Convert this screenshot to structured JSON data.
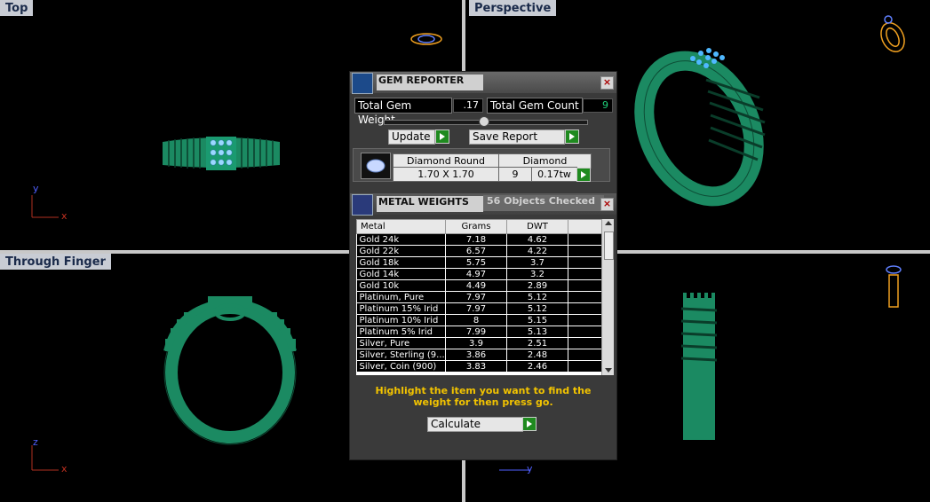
{
  "viewports": {
    "top": {
      "label": "Top",
      "axes": {
        "vertical": "y",
        "horizontal": "x"
      }
    },
    "perspective": {
      "label": "Perspective"
    },
    "through_finger": {
      "label": "Through Finger",
      "axes": {
        "vertical": "z",
        "horizontal": "x"
      }
    },
    "side": {
      "axes": {
        "horizontal": "y"
      }
    }
  },
  "gem_reporter": {
    "title": "GEM REPORTER",
    "total_gem_weight_label": "Total Gem Weight",
    "total_gem_weight": ".17",
    "total_gem_count_label": "Total Gem Count",
    "total_gem_count": "9",
    "update_label": "Update",
    "save_report_label": "Save Report",
    "gem": {
      "shape": "Diamond Round",
      "size": "1.70 X 1.70",
      "type": "Diamond",
      "count": "9",
      "weight": "0.17tw"
    }
  },
  "metal_weights": {
    "title": "METAL WEIGHTS",
    "objects_checked": "56 Objects Checked",
    "columns": [
      "Metal",
      "Grams",
      "DWT"
    ],
    "rows": [
      {
        "metal": "Gold 24k",
        "grams": "7.18",
        "dwt": "4.62"
      },
      {
        "metal": "Gold 22k",
        "grams": "6.57",
        "dwt": "4.22"
      },
      {
        "metal": "Gold 18k",
        "grams": "5.75",
        "dwt": "3.7"
      },
      {
        "metal": "Gold 14k",
        "grams": "4.97",
        "dwt": "3.2"
      },
      {
        "metal": "Gold 10k",
        "grams": "4.49",
        "dwt": "2.89"
      },
      {
        "metal": "Platinum, Pure",
        "grams": "7.97",
        "dwt": "5.12"
      },
      {
        "metal": "Platinum 15% Irid",
        "grams": "7.97",
        "dwt": "5.12"
      },
      {
        "metal": "Platinum 10% Irid",
        "grams": "8",
        "dwt": "5.15"
      },
      {
        "metal": "Platinum 5% Irid",
        "grams": "7.99",
        "dwt": "5.13"
      },
      {
        "metal": "Silver, Pure",
        "grams": "3.9",
        "dwt": "2.51"
      },
      {
        "metal": "Silver, Sterling (9...",
        "grams": "3.86",
        "dwt": "2.48"
      },
      {
        "metal": "Silver, Coin (900)",
        "grams": "3.83",
        "dwt": "2.46"
      }
    ],
    "hint": "Highlight the item you want to find the weight for then press go.",
    "calculate_label": "Calculate"
  },
  "colors": {
    "ring_green": "#1b8a62",
    "hint_yellow": "#f2c300",
    "go_green": "#1f8a1f",
    "viewport_label_bg": "#c8ccd4"
  }
}
